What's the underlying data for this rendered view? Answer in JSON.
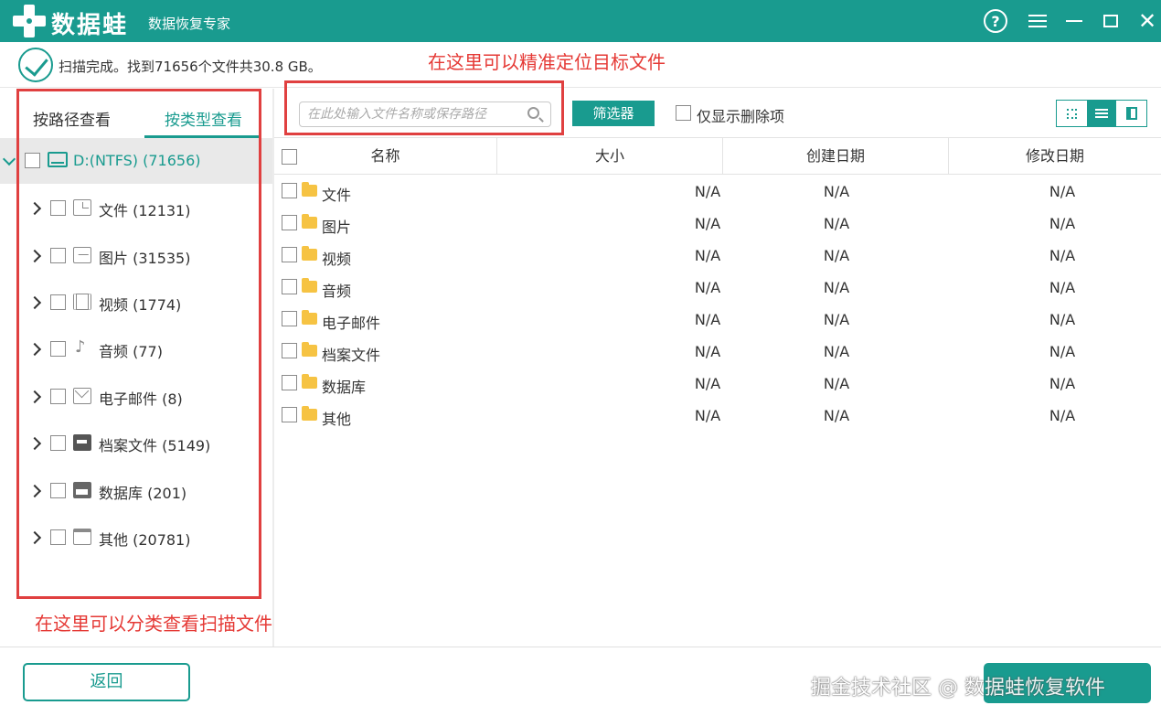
{
  "app": {
    "brand": "数据蛙",
    "subtitle": "数据恢复专家",
    "help_symbol": "?",
    "close_symbol": "✕"
  },
  "status": {
    "text": "扫描完成。找到71656个文件共30.8 GB。"
  },
  "annotations": {
    "top": "在这里可以精准定位目标文件",
    "bottom": "在这里可以分类查看扫描文件"
  },
  "left_tabs": {
    "by_path": "按路径查看",
    "by_type": "按类型查看"
  },
  "tree": {
    "root": "D:(NTFS) (71656)",
    "items": [
      {
        "label": "文件 (12131)",
        "icon": "document-icon"
      },
      {
        "label": "图片 (31535)",
        "icon": "image-icon"
      },
      {
        "label": "视频 (1774)",
        "icon": "video-icon"
      },
      {
        "label": "音频 (77)",
        "icon": "audio-icon"
      },
      {
        "label": "电子邮件 (8)",
        "icon": "email-icon"
      },
      {
        "label": "档案文件 (5149)",
        "icon": "archive-icon"
      },
      {
        "label": "数据库 (201)",
        "icon": "database-icon"
      },
      {
        "label": "其他 (20781)",
        "icon": "folder-icon"
      }
    ]
  },
  "toolbar": {
    "search_placeholder": "在此处输入文件名称或保存路径",
    "filter_label": "筛选器",
    "deleted_only_label": "仅显示删除项"
  },
  "table": {
    "columns": [
      "名称",
      "大小",
      "创建日期",
      "修改日期"
    ],
    "rows": [
      {
        "name": "文件",
        "size": "N/A",
        "created": "N/A",
        "modified": "N/A"
      },
      {
        "name": "图片",
        "size": "N/A",
        "created": "N/A",
        "modified": "N/A"
      },
      {
        "name": "视频",
        "size": "N/A",
        "created": "N/A",
        "modified": "N/A"
      },
      {
        "name": "音频",
        "size": "N/A",
        "created": "N/A",
        "modified": "N/A"
      },
      {
        "name": "电子邮件",
        "size": "N/A",
        "created": "N/A",
        "modified": "N/A"
      },
      {
        "name": "档案文件",
        "size": "N/A",
        "created": "N/A",
        "modified": "N/A"
      },
      {
        "name": "数据库",
        "size": "N/A",
        "created": "N/A",
        "modified": "N/A"
      },
      {
        "name": "其他",
        "size": "N/A",
        "created": "N/A",
        "modified": "N/A"
      }
    ]
  },
  "footer": {
    "back_label": "返回",
    "watermark": "掘金技术社区 @ 数据蛙恢复软件"
  },
  "colors": {
    "accent": "#199b8f",
    "annotation": "#e53935",
    "folder": "#f6c343"
  }
}
